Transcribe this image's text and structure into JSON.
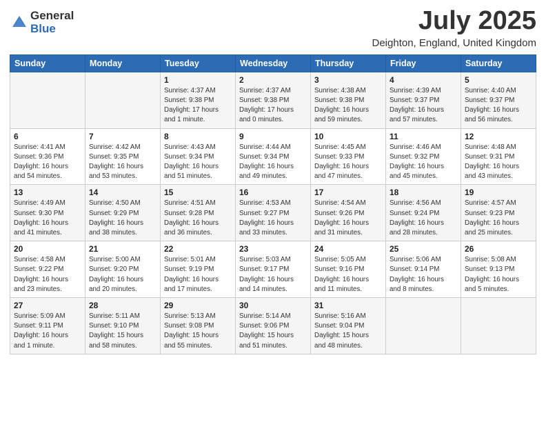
{
  "header": {
    "logo_general": "General",
    "logo_blue": "Blue",
    "main_title": "July 2025",
    "subtitle": "Deighton, England, United Kingdom"
  },
  "days_of_week": [
    "Sunday",
    "Monday",
    "Tuesday",
    "Wednesday",
    "Thursday",
    "Friday",
    "Saturday"
  ],
  "weeks": [
    [
      {
        "day": "",
        "info": ""
      },
      {
        "day": "",
        "info": ""
      },
      {
        "day": "1",
        "info": "Sunrise: 4:37 AM\nSunset: 9:38 PM\nDaylight: 17 hours\nand 1 minute."
      },
      {
        "day": "2",
        "info": "Sunrise: 4:37 AM\nSunset: 9:38 PM\nDaylight: 17 hours\nand 0 minutes."
      },
      {
        "day": "3",
        "info": "Sunrise: 4:38 AM\nSunset: 9:38 PM\nDaylight: 16 hours\nand 59 minutes."
      },
      {
        "day": "4",
        "info": "Sunrise: 4:39 AM\nSunset: 9:37 PM\nDaylight: 16 hours\nand 57 minutes."
      },
      {
        "day": "5",
        "info": "Sunrise: 4:40 AM\nSunset: 9:37 PM\nDaylight: 16 hours\nand 56 minutes."
      }
    ],
    [
      {
        "day": "6",
        "info": "Sunrise: 4:41 AM\nSunset: 9:36 PM\nDaylight: 16 hours\nand 54 minutes."
      },
      {
        "day": "7",
        "info": "Sunrise: 4:42 AM\nSunset: 9:35 PM\nDaylight: 16 hours\nand 53 minutes."
      },
      {
        "day": "8",
        "info": "Sunrise: 4:43 AM\nSunset: 9:34 PM\nDaylight: 16 hours\nand 51 minutes."
      },
      {
        "day": "9",
        "info": "Sunrise: 4:44 AM\nSunset: 9:34 PM\nDaylight: 16 hours\nand 49 minutes."
      },
      {
        "day": "10",
        "info": "Sunrise: 4:45 AM\nSunset: 9:33 PM\nDaylight: 16 hours\nand 47 minutes."
      },
      {
        "day": "11",
        "info": "Sunrise: 4:46 AM\nSunset: 9:32 PM\nDaylight: 16 hours\nand 45 minutes."
      },
      {
        "day": "12",
        "info": "Sunrise: 4:48 AM\nSunset: 9:31 PM\nDaylight: 16 hours\nand 43 minutes."
      }
    ],
    [
      {
        "day": "13",
        "info": "Sunrise: 4:49 AM\nSunset: 9:30 PM\nDaylight: 16 hours\nand 41 minutes."
      },
      {
        "day": "14",
        "info": "Sunrise: 4:50 AM\nSunset: 9:29 PM\nDaylight: 16 hours\nand 38 minutes."
      },
      {
        "day": "15",
        "info": "Sunrise: 4:51 AM\nSunset: 9:28 PM\nDaylight: 16 hours\nand 36 minutes."
      },
      {
        "day": "16",
        "info": "Sunrise: 4:53 AM\nSunset: 9:27 PM\nDaylight: 16 hours\nand 33 minutes."
      },
      {
        "day": "17",
        "info": "Sunrise: 4:54 AM\nSunset: 9:26 PM\nDaylight: 16 hours\nand 31 minutes."
      },
      {
        "day": "18",
        "info": "Sunrise: 4:56 AM\nSunset: 9:24 PM\nDaylight: 16 hours\nand 28 minutes."
      },
      {
        "day": "19",
        "info": "Sunrise: 4:57 AM\nSunset: 9:23 PM\nDaylight: 16 hours\nand 25 minutes."
      }
    ],
    [
      {
        "day": "20",
        "info": "Sunrise: 4:58 AM\nSunset: 9:22 PM\nDaylight: 16 hours\nand 23 minutes."
      },
      {
        "day": "21",
        "info": "Sunrise: 5:00 AM\nSunset: 9:20 PM\nDaylight: 16 hours\nand 20 minutes."
      },
      {
        "day": "22",
        "info": "Sunrise: 5:01 AM\nSunset: 9:19 PM\nDaylight: 16 hours\nand 17 minutes."
      },
      {
        "day": "23",
        "info": "Sunrise: 5:03 AM\nSunset: 9:17 PM\nDaylight: 16 hours\nand 14 minutes."
      },
      {
        "day": "24",
        "info": "Sunrise: 5:05 AM\nSunset: 9:16 PM\nDaylight: 16 hours\nand 11 minutes."
      },
      {
        "day": "25",
        "info": "Sunrise: 5:06 AM\nSunset: 9:14 PM\nDaylight: 16 hours\nand 8 minutes."
      },
      {
        "day": "26",
        "info": "Sunrise: 5:08 AM\nSunset: 9:13 PM\nDaylight: 16 hours\nand 5 minutes."
      }
    ],
    [
      {
        "day": "27",
        "info": "Sunrise: 5:09 AM\nSunset: 9:11 PM\nDaylight: 16 hours\nand 1 minute."
      },
      {
        "day": "28",
        "info": "Sunrise: 5:11 AM\nSunset: 9:10 PM\nDaylight: 15 hours\nand 58 minutes."
      },
      {
        "day": "29",
        "info": "Sunrise: 5:13 AM\nSunset: 9:08 PM\nDaylight: 15 hours\nand 55 minutes."
      },
      {
        "day": "30",
        "info": "Sunrise: 5:14 AM\nSunset: 9:06 PM\nDaylight: 15 hours\nand 51 minutes."
      },
      {
        "day": "31",
        "info": "Sunrise: 5:16 AM\nSunset: 9:04 PM\nDaylight: 15 hours\nand 48 minutes."
      },
      {
        "day": "",
        "info": ""
      },
      {
        "day": "",
        "info": ""
      }
    ]
  ]
}
